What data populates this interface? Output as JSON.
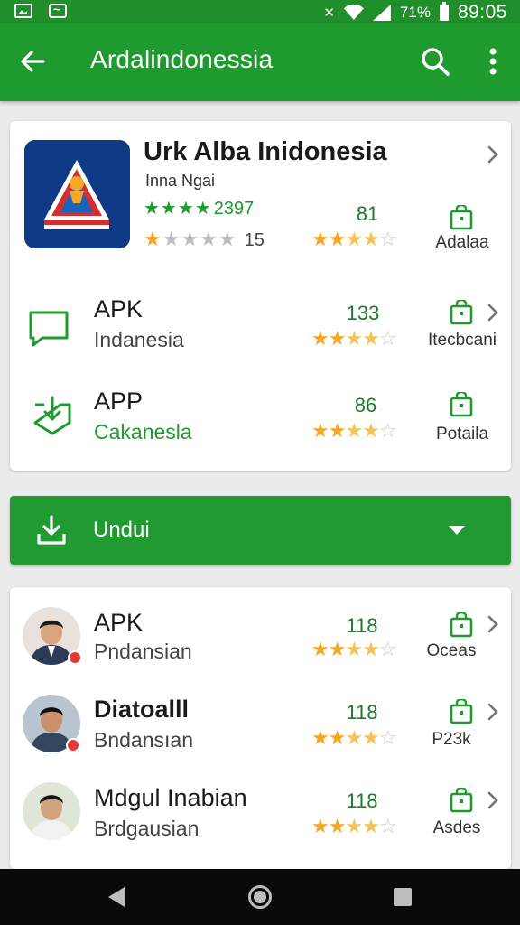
{
  "status_bar": {
    "battery": "71%",
    "time": "89:05"
  },
  "app_bar": {
    "title": "Ardalindonessia",
    "back_icon": "arrow-back-icon",
    "search_icon": "search-icon",
    "more_icon": "more-vert-icon"
  },
  "featured": {
    "title": "Urk Alba Inidonesia",
    "subtitle": "Inna Ngai",
    "green_stars": "★★★★",
    "rating_count": "2397",
    "grey_stars_on": "★",
    "grey_stars_off": "★★★★",
    "grey_count": "15",
    "number": "81",
    "stars": {
      "full": "★★",
      "half": "★★",
      "off": "☆"
    },
    "bag_label": "Adalaa",
    "rating_fraction": 0.2
  },
  "top_rows": [
    {
      "title": "APK",
      "subtitle": "Indanesia",
      "number": "133",
      "bag_label": "Itecbcani",
      "icon": "message-icon"
    },
    {
      "title": "APP",
      "subtitle": "Cakanesla",
      "number": "86",
      "bag_label": "Potaila",
      "icon": "download-shield-icon"
    }
  ],
  "unduh": {
    "label": "Undui",
    "icon": "download-icon",
    "caret": "caret-down-icon"
  },
  "people": [
    {
      "title": "APK",
      "subtitle": "Pndansian",
      "number": "118",
      "bag_label": "Oceas"
    },
    {
      "title": "Diatoalll",
      "subtitle": "Bndansıan",
      "number": "118",
      "bag_label": "P23k"
    },
    {
      "title": "Mdgul Inabian",
      "subtitle": "Brdgausian",
      "number": "118",
      "bag_label": "Asdes"
    }
  ],
  "colors": {
    "primary": "#1f9a2e",
    "status_bar": "#1f8e2b",
    "star": "#f5a623",
    "background": "#ececec"
  }
}
